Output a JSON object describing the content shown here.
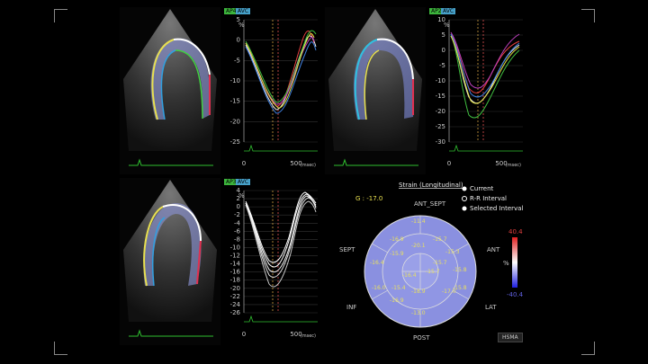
{
  "tags": {
    "ap4": "AP4",
    "avc": "AVC",
    "ap2": "AP2",
    "ap3": "AP3"
  },
  "graph_top_right": {
    "y_ticks": [
      "10",
      "5",
      "0",
      "-5",
      "-10",
      "-15",
      "-20",
      "-25",
      "-30"
    ],
    "x_ticks": [
      "0",
      "500"
    ],
    "x_unit": "(msec)",
    "y_unit": "%"
  },
  "graph_top_middle": {
    "y_ticks": [
      "5",
      "0",
      "-5",
      "-10",
      "-15",
      "-20",
      "-25"
    ],
    "x_ticks": [
      "0",
      "500"
    ],
    "x_unit": "(msec)",
    "y_unit": "%"
  },
  "graph_bottom": {
    "y_ticks": [
      "4",
      "2",
      "0",
      "-2",
      "-4",
      "-6",
      "-8",
      "-10",
      "-12",
      "-14",
      "-16",
      "-18",
      "-20",
      "-22",
      "-24",
      "-26"
    ],
    "x_ticks": [
      "0",
      "500"
    ],
    "x_unit": "(msec)",
    "y_unit": "%"
  },
  "bullseye": {
    "title": "Strain (Longitudinal)",
    "global": "G : -17.0",
    "legend": [
      "Current",
      "R-R Interval",
      "Selected Interval"
    ],
    "labels": {
      "ant_sept": "ANT_SEPT",
      "ant": "ANT",
      "lat": "LAT",
      "post": "POST",
      "inf": "INF",
      "sept": "SEPT"
    },
    "scale_max": "40.4",
    "scale_min": "-40.4",
    "scale_unit": "%",
    "segments": [
      "-11.4",
      "-16.9",
      "-15.7",
      "-15.3",
      "-20.1",
      "-15.9",
      "-16.4",
      "-15.7",
      "-15.8",
      "-15.7",
      "-16.4",
      "-15.4",
      "-16.0",
      "-17.0",
      "-18.9",
      "-16.9",
      "-13.0",
      "-15.8"
    ]
  },
  "logo": "HSMA"
}
